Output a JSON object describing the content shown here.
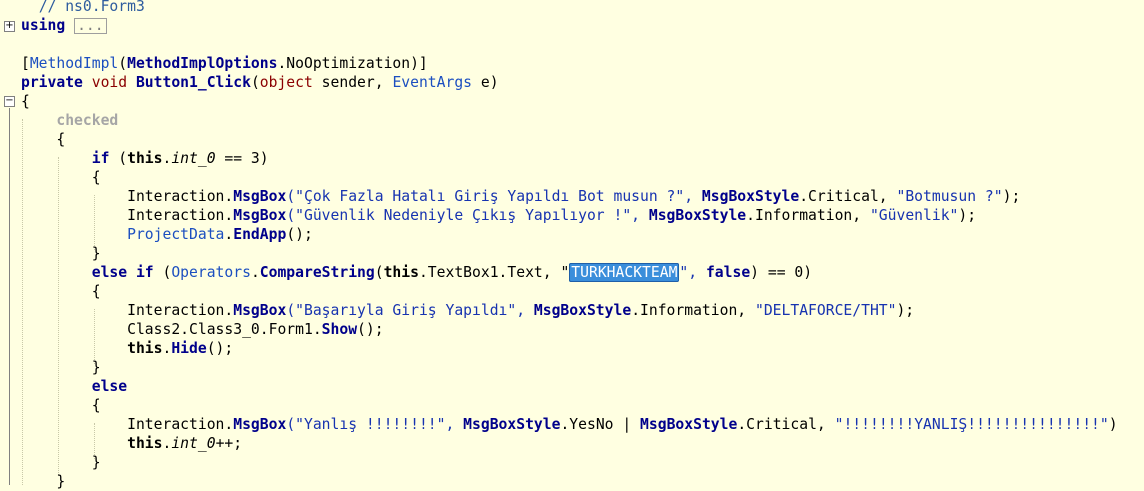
{
  "code": {
    "comment": "// ns0.Form3",
    "using_kw": "using",
    "using_ellipsis": "...",
    "attribute": {
      "open": "[",
      "impl": "MethodImpl",
      "paren_open": "(",
      "options": "MethodImplOptions",
      "member": ".NoOptimization",
      "close": ")]"
    },
    "signature": {
      "private": "private",
      "void": "void",
      "name": "Button1_Click",
      "paren_open": "(",
      "object": "object",
      "sender": " sender, ",
      "eventargs": "EventArgs",
      "e": " e)"
    },
    "brace_open": "{",
    "brace_close": "}",
    "checked": "checked",
    "if_kw": "if",
    "if_cond_a": " (",
    "this_kw": "this",
    "int0": "int_0",
    "if_cond_b": " == 3)",
    "interaction": "Interaction",
    "msgbox": "MsgBox",
    "msgboxstyle": "MsgBoxStyle",
    "line_msg1_a": "(\"Çok Fazla Hatalı Giriş Yapıldı Bot musun ?\", ",
    "line_msg1_b": ".Critical, ",
    "line_msg1_c": "\"Botmusun ?\"",
    "line_msg1_d": ");",
    "line_msg2_a": "(\"Güvenlik Nedeniyle Çıkış Yapılıyor !\", ",
    "line_msg2_b": ".Information, ",
    "line_msg2_c": "\"Güvenlik\"",
    "line_msg2_d": ");",
    "projectdata": "ProjectData",
    "endapp": "EndApp",
    "call_end": "();",
    "else_kw": "else",
    "elseif_a": " (",
    "operators": "Operators",
    "comparestring": "CompareString",
    "elseif_b": "(",
    "elseif_c": ".TextBox1.Text, \"",
    "highlight": "TURKHACKTEAM",
    "elseif_d": "\", ",
    "false_kw": "false",
    "elseif_e": ") == 0)",
    "line_msg3_a": "(\"Başarıyla Giriş Yapıldı\", ",
    "line_msg3_b": ".Information, ",
    "line_msg3_c": "\"DELTAFORCE/THT\"",
    "line_msg3_d": ");",
    "class2": "Class2.Class3_0.Form1.",
    "show": "Show",
    "hide": "Hide",
    "dot": ".",
    "line_msg4_a": "(\"Yanlış !!!!!!!!\", ",
    "line_msg4_b": ".YesNo | ",
    "line_msg4_c": ".Critical, ",
    "line_msg4_d": "\"!!!!!!!!YANLIŞ!!!!!!!!!!!!!!!\"",
    "line_msg4_e": ")",
    "int0_inc": "++;"
  },
  "colors": {
    "background": "#FFFFE1",
    "keyword": "#00008B",
    "keyword_red": "#8B0000",
    "type": "#1C4FC0",
    "string": "#1733B0",
    "selection": "#3A8EDB"
  }
}
